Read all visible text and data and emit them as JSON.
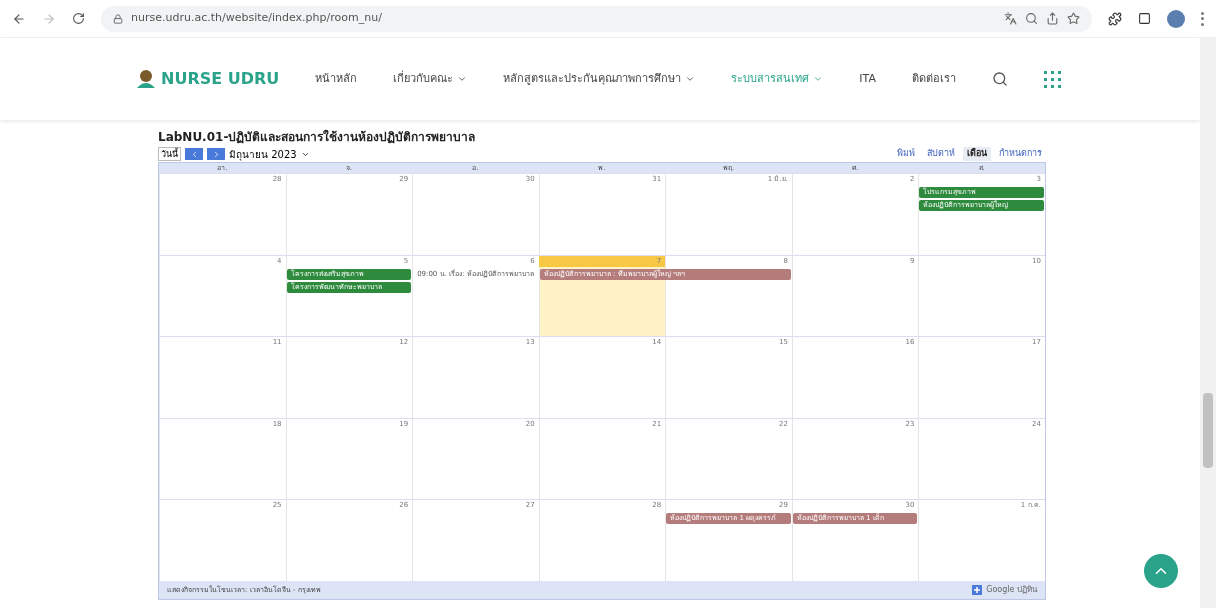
{
  "browser": {
    "url": "nurse.udru.ac.th/website/index.php/room_nu/"
  },
  "site": {
    "logo": "NURSE UDRU",
    "nav": [
      {
        "label": "หน้าหลัก",
        "dropdown": false,
        "selected": false
      },
      {
        "label": "เกี่ยวกับคณะ",
        "dropdown": true,
        "selected": false
      },
      {
        "label": "หลักสูตรและประกันคุณภาพการศึกษา",
        "dropdown": true,
        "selected": false
      },
      {
        "label": "ระบบสารสนเทศ",
        "dropdown": true,
        "selected": true
      },
      {
        "label": "ITA",
        "dropdown": false,
        "selected": false
      },
      {
        "label": "ติดต่อเรา",
        "dropdown": false,
        "selected": false
      }
    ]
  },
  "calendar": {
    "title": "LabNU.01-ปฏิบัติและสอนการใช้งานห้องปฏิบัติการพยาบาล",
    "today_button": "วันนี้",
    "month": "มิถุนายน 2023",
    "views": [
      {
        "label": "พิมพ์",
        "selected": false
      },
      {
        "label": "สัปดาห์",
        "selected": false
      },
      {
        "label": "เดือน",
        "selected": true
      },
      {
        "label": "กำหนดการ",
        "selected": false
      }
    ],
    "weekdays": [
      "อา.",
      "จ.",
      "อ.",
      "พ.",
      "พฤ.",
      "ศ.",
      "ส."
    ],
    "weeks": [
      {
        "days": [
          {
            "label": "28",
            "today": false
          },
          {
            "label": "29",
            "today": false
          },
          {
            "label": "30",
            "today": false
          },
          {
            "label": "31",
            "today": false
          },
          {
            "label": "1 มิ.ย.",
            "today": false
          },
          {
            "label": "2",
            "today": false
          },
          {
            "label": "3",
            "today": false,
            "events": [
              {
                "kind": "block",
                "title": "โปรแกรมสุขภาพ",
                "color": "#2e8b3e"
              },
              {
                "kind": "block",
                "title": "ห้องปฏิบัติการพยาบาลผู้ใหญ่",
                "color": "#2e8b3e"
              }
            ]
          }
        ]
      },
      {
        "days": [
          {
            "label": "4",
            "today": false
          },
          {
            "label": "5",
            "today": false,
            "events": [
              {
                "kind": "block",
                "title": "โครงการส่งเสริมสุขภาพ",
                "color": "#2e8b3e"
              },
              {
                "kind": "block",
                "title": "โครงการพัฒนาทักษะพยาบาล",
                "color": "#2e8b3e"
              }
            ]
          },
          {
            "label": "6",
            "today": false,
            "events": [
              {
                "kind": "text",
                "title": "09:00 น. เรื่อง: ห้องปฏิบัติการพยาบาล"
              }
            ]
          },
          {
            "label": "7",
            "today": true,
            "events": [
              {
                "kind": "wide",
                "title": "ห้องปฏิบัติการพยาบาล : ทีมพยาบาลผู้ใหญ่ ฯลฯ",
                "color": "#b57c7c"
              }
            ]
          },
          {
            "label": "8",
            "today": false
          },
          {
            "label": "9",
            "today": false
          },
          {
            "label": "10",
            "today": false
          }
        ]
      },
      {
        "days": [
          {
            "label": "11",
            "today": false
          },
          {
            "label": "12",
            "today": false
          },
          {
            "label": "13",
            "today": false
          },
          {
            "label": "14",
            "today": false
          },
          {
            "label": "15",
            "today": false
          },
          {
            "label": "16",
            "today": false
          },
          {
            "label": "17",
            "today": false
          }
        ]
      },
      {
        "days": [
          {
            "label": "18",
            "today": false
          },
          {
            "label": "19",
            "today": false
          },
          {
            "label": "20",
            "today": false
          },
          {
            "label": "21",
            "today": false
          },
          {
            "label": "22",
            "today": false
          },
          {
            "label": "23",
            "today": false
          },
          {
            "label": "24",
            "today": false
          }
        ]
      },
      {
        "days": [
          {
            "label": "25",
            "today": false
          },
          {
            "label": "26",
            "today": false
          },
          {
            "label": "27",
            "today": false
          },
          {
            "label": "28",
            "today": false
          },
          {
            "label": "29",
            "today": false,
            "events": [
              {
                "kind": "block",
                "title": "ห้องปฏิบัติการพยาบาล 1 ผดุงครรภ์",
                "color": "#b57c7c"
              }
            ]
          },
          {
            "label": "30",
            "today": false,
            "events": [
              {
                "kind": "block",
                "title": "ห้องปฏิบัติการพยาบาล 1 เด็ก",
                "color": "#b57c7c"
              }
            ]
          },
          {
            "label": "1 ก.ค.",
            "today": false
          }
        ]
      }
    ],
    "timezone": "แสดงกิจกรรมในโซนเวลา: เวลาอินโดจีน - กรุงเทพ",
    "google_badge": "Google ปฏิทิน"
  }
}
